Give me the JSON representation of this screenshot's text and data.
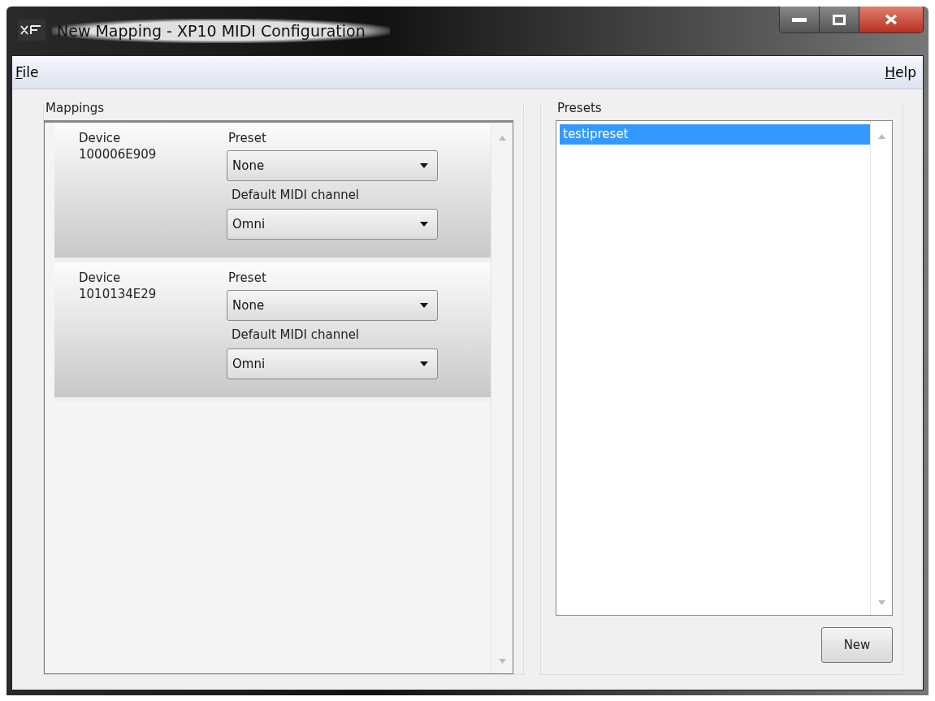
{
  "window": {
    "title": "New Mapping - XP10 MIDI Configuration"
  },
  "menu": [
    {
      "label": "File"
    },
    {
      "label": "Help"
    }
  ],
  "mappings": {
    "title": "Mappings",
    "devices": [
      {
        "label": "Device",
        "id": "100006E909",
        "preset_label": "Preset",
        "preset": "None",
        "channel_label": "Default MIDI channel",
        "channel": "Omni"
      },
      {
        "label": "Device",
        "id": "1010134E29",
        "preset_label": "Preset",
        "preset": "None",
        "channel_label": "Default MIDI channel",
        "channel": "Omni"
      }
    ]
  },
  "presets": {
    "title": "Presets",
    "items": [
      {
        "label": "testipreset",
        "selected": true
      }
    ],
    "button": "New"
  }
}
